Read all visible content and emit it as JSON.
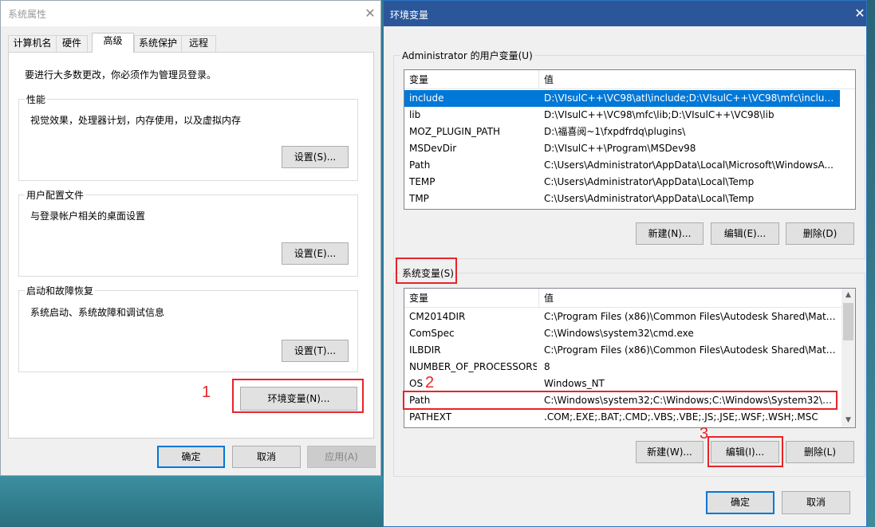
{
  "sys_props": {
    "title": "系统属性",
    "close_icon": "close-icon",
    "tabs": [
      "计算机名",
      "硬件",
      "高级",
      "系统保护",
      "远程"
    ],
    "active_tab": "高级",
    "intro": "要进行大多数更改，你必须作为管理员登录。",
    "performance": {
      "title": "性能",
      "desc": "视觉效果，处理器计划，内存使用，以及虚拟内存",
      "button": "设置(S)..."
    },
    "user_profiles": {
      "title": "用户配置文件",
      "desc": "与登录帐户相关的桌面设置",
      "button": "设置(E)..."
    },
    "startup_recovery": {
      "title": "启动和故障恢复",
      "desc": "系统启动、系统故障和调试信息",
      "button": "设置(T)..."
    },
    "env_button": "环境变量(N)...",
    "ok": "确定",
    "cancel": "取消",
    "apply": "应用(A)"
  },
  "env_vars": {
    "title": "环境变量",
    "close_icon": "close-icon",
    "user_group_title": "Administrator 的用户变量(U)",
    "col_var": "变量",
    "col_val": "值",
    "user_vars": [
      {
        "name": "include",
        "value": "D:\\VIsulC++\\VC98\\atl\\include;D:\\VIsulC++\\VC98\\mfc\\include;..."
      },
      {
        "name": "lib",
        "value": "D:\\VIsulC++\\VC98\\mfc\\lib;D:\\VIsulC++\\VC98\\lib"
      },
      {
        "name": "MOZ_PLUGIN_PATH",
        "value": "D:\\福喜阅~1\\fxpdfrdq\\plugins\\"
      },
      {
        "name": "MSDevDir",
        "value": "D:\\VIsulC++\\Program\\MSDev98"
      },
      {
        "name": "Path",
        "value": "C:\\Users\\Administrator\\AppData\\Local\\Microsoft\\WindowsA..."
      },
      {
        "name": "TEMP",
        "value": "C:\\Users\\Administrator\\AppData\\Local\\Temp"
      },
      {
        "name": "TMP",
        "value": "C:\\Users\\Administrator\\AppData\\Local\\Temp"
      }
    ],
    "user_buttons": {
      "new": "新建(N)...",
      "edit": "编辑(E)...",
      "delete": "删除(D)"
    },
    "sys_group_title": "系统变量(S)",
    "sys_vars": [
      {
        "name": "CM2014DIR",
        "value": "C:\\Program Files (x86)\\Common Files\\Autodesk Shared\\Mate..."
      },
      {
        "name": "ComSpec",
        "value": "C:\\Windows\\system32\\cmd.exe"
      },
      {
        "name": "ILBDIR",
        "value": "C:\\Program Files (x86)\\Common Files\\Autodesk Shared\\Mate..."
      },
      {
        "name": "NUMBER_OF_PROCESSORS",
        "value": "8"
      },
      {
        "name": "OS",
        "value": "Windows_NT"
      },
      {
        "name": "Path",
        "value": "C:\\Windows\\system32;C:\\Windows;C:\\Windows\\System32\\Wb..."
      },
      {
        "name": "PATHEXT",
        "value": ".COM;.EXE;.BAT;.CMD;.VBS;.VBE;.JS;.JSE;.WSF;.WSH;.MSC"
      }
    ],
    "sys_buttons": {
      "new": "新建(W)...",
      "edit": "编辑(I)...",
      "delete": "删除(L)"
    },
    "ok": "确定",
    "cancel": "取消"
  },
  "annotations": {
    "step1": "1",
    "step2": "2",
    "step3": "3",
    "color": "#e8232a"
  },
  "colors": {
    "selection": "#0078d7",
    "titlebar_active": "#2b579a"
  }
}
